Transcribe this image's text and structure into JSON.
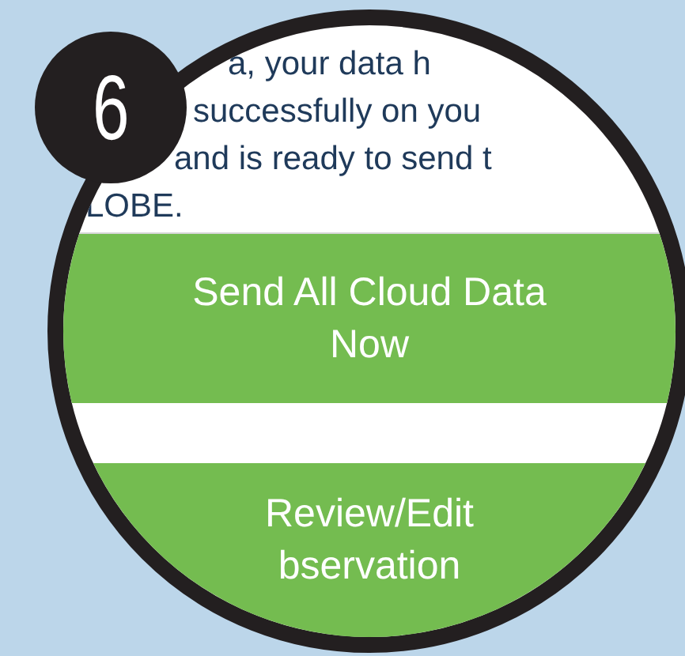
{
  "step_badge": {
    "number": "6"
  },
  "message_lines": [
    "a, your data h",
    "successfully on you",
    "and is ready to send t",
    "LOBE."
  ],
  "buttons": [
    {
      "label": "Send All Cloud Data Now"
    },
    {
      "label": "Review/Edit bservation"
    }
  ]
}
